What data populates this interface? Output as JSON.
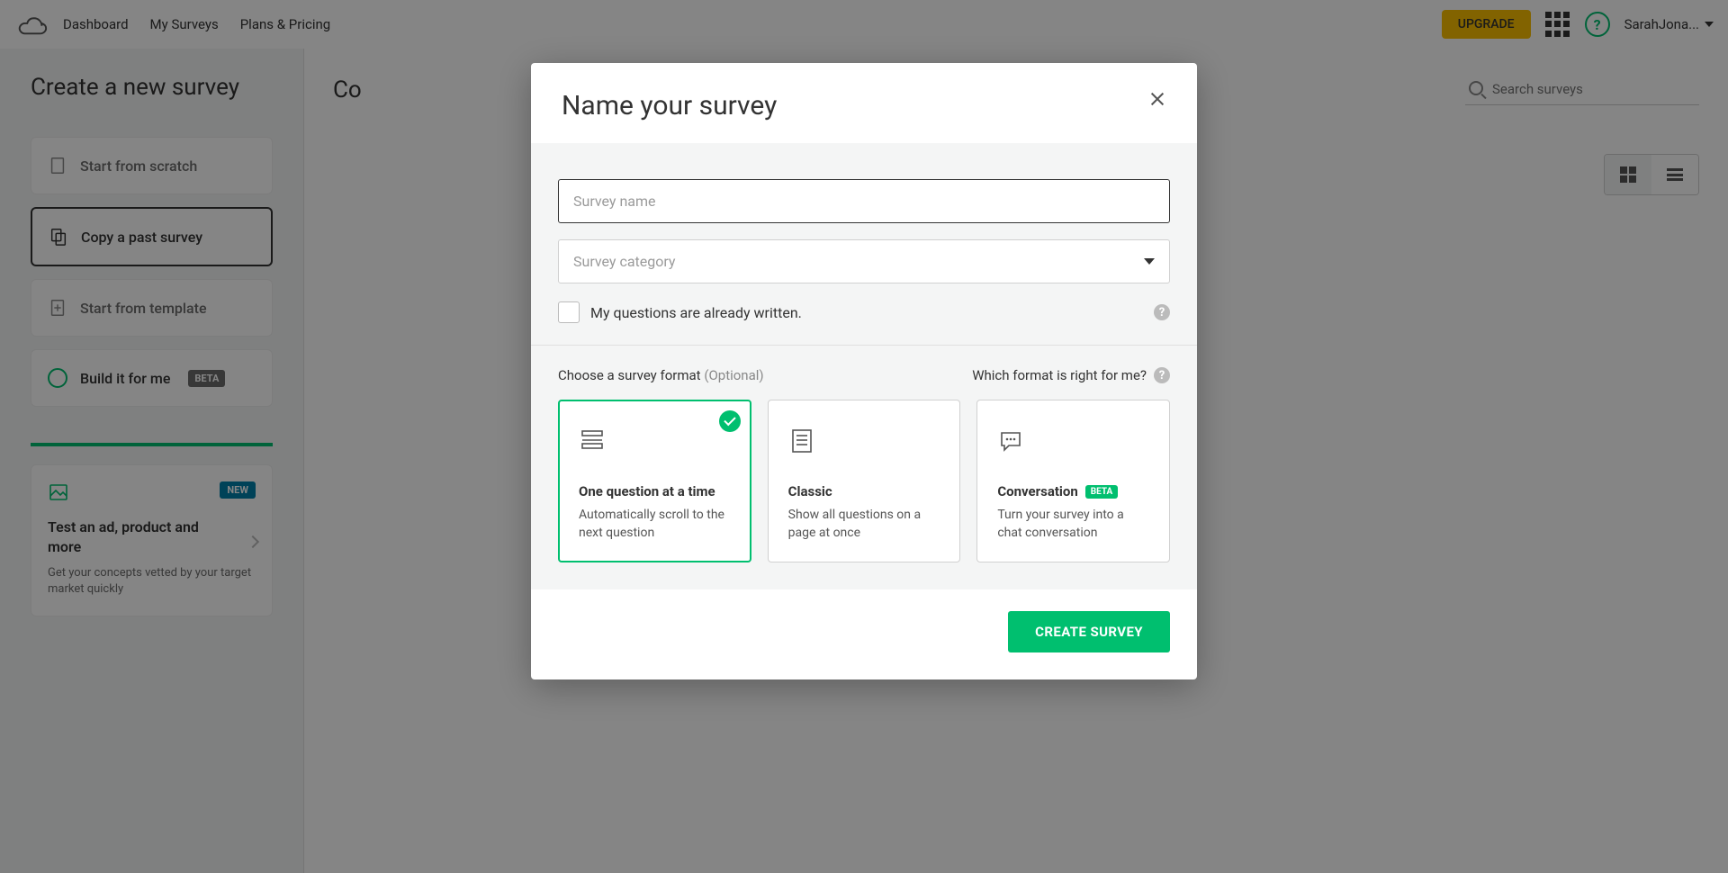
{
  "header": {
    "nav": {
      "dashboard": "Dashboard",
      "my_surveys": "My Surveys",
      "plans": "Plans & Pricing"
    },
    "upgrade": "UPGRADE",
    "username": "SarahJona..."
  },
  "sidebar": {
    "title": "Create a new survey",
    "options": {
      "scratch": "Start from scratch",
      "copy": "Copy a past survey",
      "template": "Start from template",
      "build": "Build it for me",
      "build_badge": "BETA"
    },
    "promo": {
      "new_badge": "NEW",
      "title": "Test an ad, product and more",
      "desc": "Get your concepts vetted by your target market quickly"
    }
  },
  "content": {
    "title": "Co",
    "search_placeholder": "Search surveys"
  },
  "modal": {
    "title": "Name your survey",
    "name_placeholder": "Survey name",
    "category_placeholder": "Survey category",
    "checkbox_label": "My questions are already written.",
    "format_label": "Choose a survey format ",
    "format_optional": "(Optional)",
    "which_format": "Which format is right for me?",
    "formats": {
      "one": {
        "title": "One question at a time",
        "desc": "Automatically scroll to the next question"
      },
      "classic": {
        "title": "Classic",
        "desc": "Show all questions on a page at once"
      },
      "conversation": {
        "title": "Conversation",
        "badge": "BETA",
        "desc": "Turn your survey into a chat conversation"
      }
    },
    "create_button": "CREATE SURVEY"
  }
}
